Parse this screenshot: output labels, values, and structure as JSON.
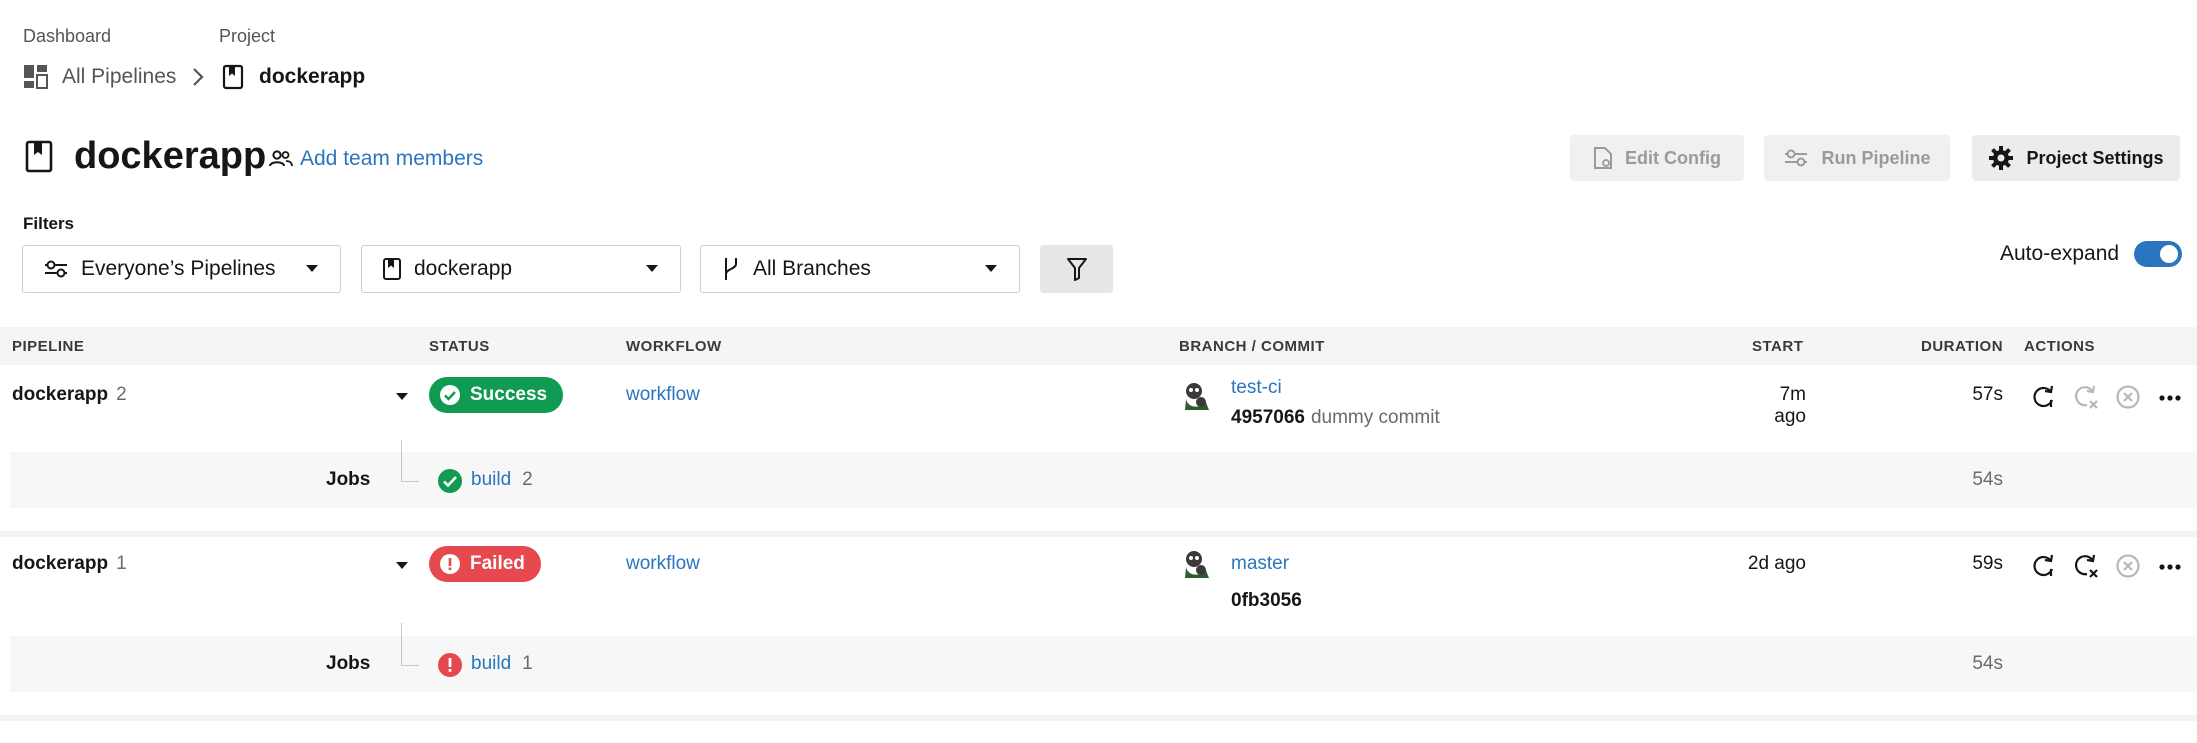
{
  "breadcrumb": {
    "dashboard_label": "Dashboard",
    "dashboard_item": "All Pipelines",
    "project_label": "Project",
    "project_item": "dockerapp"
  },
  "header": {
    "project_title": "dockerapp",
    "add_team_members": "Add team members",
    "edit_config": "Edit Config",
    "run_pipeline": "Run Pipeline",
    "project_settings": "Project Settings"
  },
  "filters": {
    "label": "Filters",
    "pipelines_filter": "Everyone’s Pipelines",
    "project_filter": "dockerapp",
    "branch_filter": "All Branches",
    "auto_expand_label": "Auto-expand",
    "auto_expand_on": true
  },
  "table": {
    "columns": [
      "PIPELINE",
      "STATUS",
      "WORKFLOW",
      "BRANCH / COMMIT",
      "START",
      "DURATION",
      "ACTIONS"
    ],
    "rows": [
      {
        "pipeline_name": "dockerapp",
        "pipeline_number": "2",
        "status": "Success",
        "workflow": "workflow",
        "branch": "test-ci",
        "commit_hash": "4957066",
        "commit_message": "dummy commit",
        "start": "7m ago",
        "duration": "57s",
        "jobs_label": "Jobs",
        "job_name": "build",
        "job_number": "2",
        "job_duration": "54s"
      },
      {
        "pipeline_name": "dockerapp",
        "pipeline_number": "1",
        "status": "Failed",
        "workflow": "workflow",
        "branch": "master",
        "commit_hash": "0fb3056",
        "commit_message": "",
        "start": "2d ago",
        "duration": "59s",
        "jobs_label": "Jobs",
        "job_name": "build",
        "job_number": "1",
        "job_duration": "54s"
      }
    ]
  },
  "colors": {
    "link": "#2a75c0",
    "success": "#109a52",
    "failed": "#e5484d",
    "toggle": "#2a75c0"
  },
  "icons": {
    "dashboard": "dashboard-grid-icon",
    "project": "bookmark-icon",
    "team": "people-icon",
    "edit_config": "file-gear-icon",
    "run_pipeline": "sliders-icon",
    "settings": "gear-icon",
    "branch": "git-branch-icon",
    "filter": "funnel-icon",
    "rerun": "rerun-icon",
    "rerun_failed": "rerun-failed-icon",
    "cancel": "cancel-circle-icon",
    "more": "more-dots-icon"
  }
}
